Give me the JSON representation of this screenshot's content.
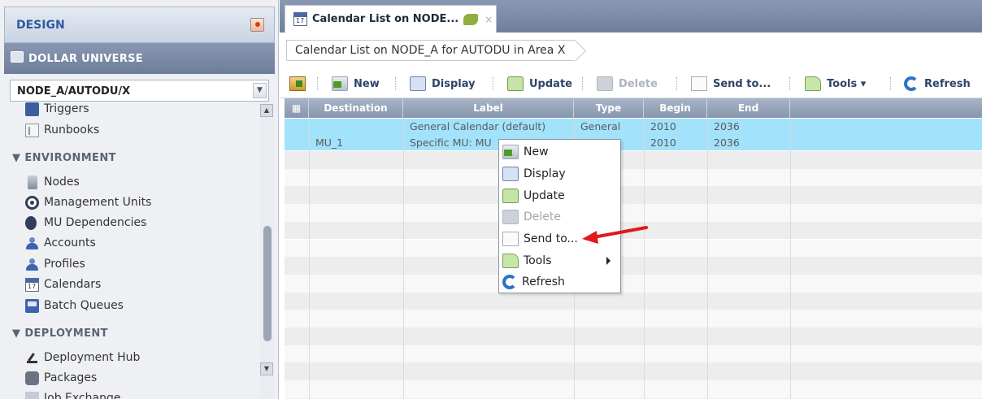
{
  "sidebar": {
    "design_label": "DESIGN",
    "universe_label": "DOLLAR UNIVERSE",
    "node_select_value": "NODE_A/AUTODU/X",
    "items": [
      {
        "label": "Triggers",
        "icon": "triggers-icon"
      },
      {
        "label": "Runbooks",
        "icon": "runbooks-icon"
      },
      {
        "label": "Nodes",
        "icon": "nodes-icon"
      },
      {
        "label": "Management Units",
        "icon": "management-units-icon"
      },
      {
        "label": "MU Dependencies",
        "icon": "mu-dependencies-icon"
      },
      {
        "label": "Accounts",
        "icon": "accounts-icon"
      },
      {
        "label": "Profiles",
        "icon": "profiles-icon"
      },
      {
        "label": "Calendars",
        "icon": "calendar-icon"
      },
      {
        "label": "Batch Queues",
        "icon": "batch-queues-icon"
      },
      {
        "label": "Deployment Hub",
        "icon": "deployment-hub-icon"
      },
      {
        "label": "Packages",
        "icon": "packages-icon"
      },
      {
        "label": "Job Exchange",
        "icon": "job-exchange-icon"
      }
    ],
    "sections": {
      "environment": "▼ ENVIRONMENT",
      "deployment": "▼ DEPLOYMENT"
    }
  },
  "tab": {
    "title": "Calendar List on NODE...",
    "close_glyph": "×"
  },
  "breadcrumb": "Calendar List on NODE_A for AUTODU in Area X",
  "toolbar": {
    "new": "New",
    "display": "Display",
    "update": "Update",
    "delete": "Delete",
    "send_to": "Send to...",
    "tools": "Tools ▾",
    "refresh": "Refresh"
  },
  "table": {
    "columns": [
      "Destination",
      "Label",
      "Type",
      "Begin",
      "End"
    ],
    "rows": [
      {
        "destination": "",
        "label": "General Calendar (default)",
        "type": "General",
        "begin": "2010",
        "end": "2036"
      },
      {
        "destination": "MU_1",
        "label": "Specific MU: MU",
        "type": "",
        "begin": "2010",
        "end": "2036"
      }
    ]
  },
  "context_menu": {
    "items": [
      {
        "label": "New",
        "disabled": false
      },
      {
        "label": "Display",
        "disabled": false
      },
      {
        "label": "Update",
        "disabled": false
      },
      {
        "label": "Delete",
        "disabled": true
      },
      {
        "label": "Send to...",
        "disabled": false
      },
      {
        "label": "Tools",
        "disabled": false
      },
      {
        "label": "Refresh",
        "disabled": false
      }
    ]
  },
  "colors": {
    "selected_row": "#a3e2fb",
    "header_bar": "#7f8ea9",
    "accent_text": "#2c5aa0",
    "callout_arrow": "#e0191b"
  }
}
